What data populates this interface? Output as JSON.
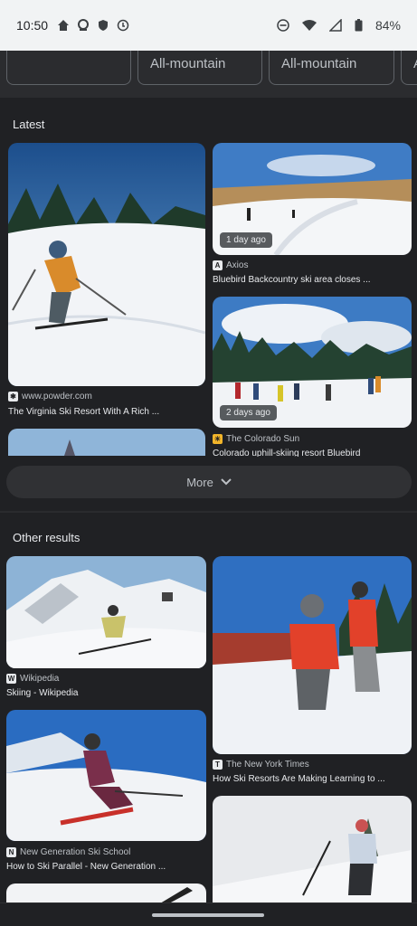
{
  "status_bar": {
    "time": "10:50",
    "battery": "84%"
  },
  "chips": [
    {
      "label": ""
    },
    {
      "label": "All-mountain"
    },
    {
      "label": "All-mountain"
    },
    {
      "label": "A"
    }
  ],
  "latest": {
    "heading": "Latest",
    "cards": [
      {
        "source": "www.powder.com",
        "title": "The Virginia Ski Resort With A Rich ...",
        "badge": ""
      },
      {
        "source": "Axios",
        "title": "Bluebird Backcountry ski area closes ...",
        "badge": "1 day ago"
      },
      {
        "source": "The Colorado Sun",
        "title": "Colorado uphill-skiing resort Bluebird",
        "badge": "2 days ago"
      }
    ]
  },
  "more_button": {
    "label": "More"
  },
  "other": {
    "heading": "Other results",
    "cards": [
      {
        "source": "Wikipedia",
        "title": "Skiing - Wikipedia"
      },
      {
        "source": "The New York Times",
        "title": "How Ski Resorts Are Making Learning to ..."
      },
      {
        "source": "New Generation Ski School",
        "title": "How to Ski Parallel - New Generation ..."
      }
    ]
  }
}
